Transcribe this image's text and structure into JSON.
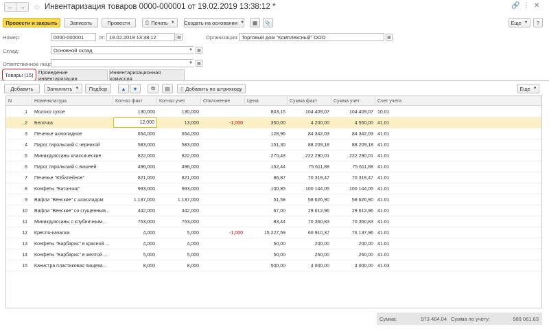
{
  "window": {
    "title": "Инвентаризация товаров 0000-000001 от 19.02.2019 13:38:12 *"
  },
  "toolbar": {
    "post_close": "Провести и закрыть",
    "save": "Записать",
    "post": "Провести",
    "print": "Печать",
    "create_based": "Создать на основании",
    "more": "Еще"
  },
  "header": {
    "number_label": "Номер:",
    "number": "0000-000001",
    "date_label": "от:",
    "date": "19.02.2019 13:38:12",
    "org_label": "Организация:",
    "org": "Торговый дом \"Комплексный\" ООО",
    "warehouse_label": "Склад:",
    "warehouse": "Основной склад",
    "responsible_label": "Ответственное лицо:",
    "responsible": ""
  },
  "tabs": [
    {
      "label": "Товары (15)"
    },
    {
      "label": "Проведение инвентаризации"
    },
    {
      "label": "Инвентаризационная комиссия"
    }
  ],
  "table_toolbar": {
    "add": "Добавить",
    "fill": "Заполнить",
    "pick": "Подбор",
    "add_barcode": "Добавить по штрихкоду",
    "more": "Еще"
  },
  "columns": [
    "N",
    "Номенклатура",
    "Кол-во факт",
    "Кол-во учет",
    "Отклонение",
    "Цена",
    "Сумма факт",
    "Сумма учет",
    "Счет учета"
  ],
  "rows": [
    {
      "n": "1",
      "name": "Молоко сухое",
      "fact": "130,000",
      "acct_qty": "130,000",
      "dev": "",
      "price": "803,15",
      "sum_fact": "104 409,07",
      "sum_acct": "104 409,07",
      "account": "10.01"
    },
    {
      "n": "2",
      "name": "Белочка",
      "fact": "12,000",
      "acct_qty": "13,000",
      "dev": "-1,000",
      "price": "350,00",
      "sum_fact": "4 200,00",
      "sum_acct": "4 550,00",
      "account": "41.01"
    },
    {
      "n": "3",
      "name": "Печенье шоколадное",
      "fact": "654,000",
      "acct_qty": "654,000",
      "dev": "",
      "price": "128,96",
      "sum_fact": "84 342,03",
      "sum_acct": "84 342,03",
      "account": "41.01"
    },
    {
      "n": "4",
      "name": "Пирог тирольский с черникой",
      "fact": "583,000",
      "acct_qty": "583,000",
      "dev": "",
      "price": "151,30",
      "sum_fact": "88 209,18",
      "sum_acct": "88 209,18",
      "account": "41.01"
    },
    {
      "n": "5",
      "name": "Миникруассаны классические",
      "fact": "822,000",
      "acct_qty": "822,000",
      "dev": "",
      "price": "270,43",
      "sum_fact": "222 290,01",
      "sum_acct": "222 290,01",
      "account": "41.01"
    },
    {
      "n": "6",
      "name": "Пирог тирольский с вишней",
      "fact": "496,000",
      "acct_qty": "496,000",
      "dev": "",
      "price": "152,44",
      "sum_fact": "75 611,88",
      "sum_acct": "75 611,88",
      "account": "41.01"
    },
    {
      "n": "7",
      "name": "Печенье \"Юбилейное\"",
      "fact": "821,000",
      "acct_qty": "821,000",
      "dev": "",
      "price": "86,87",
      "sum_fact": "70 319,47",
      "sum_acct": "70 319,47",
      "account": "41.01"
    },
    {
      "n": "8",
      "name": "Конфеты \"Батончик\"",
      "fact": "993,000",
      "acct_qty": "993,000",
      "dev": "",
      "price": "100,85",
      "sum_fact": "100 144,05",
      "sum_acct": "100 144,05",
      "account": "41.01"
    },
    {
      "n": "9",
      "name": "Вафли \"Венские\" с шоколадом",
      "fact": "1 137,000",
      "acct_qty": "1 137,000",
      "dev": "",
      "price": "51,58",
      "sum_fact": "58 626,90",
      "sum_acct": "58 626,90",
      "account": "41.01"
    },
    {
      "n": "10",
      "name": "Вафли \"Венские\" со сгущенным...",
      "fact": "442,000",
      "acct_qty": "442,000",
      "dev": "",
      "price": "67,00",
      "sum_fact": "29 612,96",
      "sum_acct": "29 612,96",
      "account": "41.01"
    },
    {
      "n": "11",
      "name": "Миникруассаны с клубничным...",
      "fact": "753,000",
      "acct_qty": "753,000",
      "dev": "",
      "price": "93,44",
      "sum_fact": "70 360,83",
      "sum_acct": "70 360,83",
      "account": "41.01"
    },
    {
      "n": "12",
      "name": "Кресло-качалка",
      "fact": "4,000",
      "acct_qty": "5,000",
      "dev": "-1,000",
      "price": "15 227,59",
      "sum_fact": "60 910,37",
      "sum_acct": "76 137,96",
      "account": "41.01"
    },
    {
      "n": "13",
      "name": "Конфеты \"Барбарис\" в красной ...",
      "fact": "4,000",
      "acct_qty": "4,000",
      "dev": "",
      "price": "50,00",
      "sum_fact": "200,00",
      "sum_acct": "200,00",
      "account": "41.01"
    },
    {
      "n": "14",
      "name": "Конфеты \"Барбарис\" в желтой ...",
      "fact": "5,000",
      "acct_qty": "5,000",
      "dev": "",
      "price": "50,00",
      "sum_fact": "250,00",
      "sum_acct": "250,00",
      "account": "41.01"
    },
    {
      "n": "15",
      "name": "Канистра пластиковая пищева...",
      "fact": "8,000",
      "acct_qty": "8,000",
      "dev": "",
      "price": "500,00",
      "sum_fact": "4 000,00",
      "sum_acct": "4 000,00",
      "account": "41.03"
    }
  ],
  "totals": {
    "sum_label": "Сумма:",
    "sum": "973 484,04",
    "acct_label": "Сумма по учету:",
    "acct": "989 061,63"
  },
  "colors": {
    "primary_button": "#fcd846",
    "selected_row": "#fbf0c4",
    "negative": "#d10000",
    "tab_highlight": "#d21c1c"
  }
}
